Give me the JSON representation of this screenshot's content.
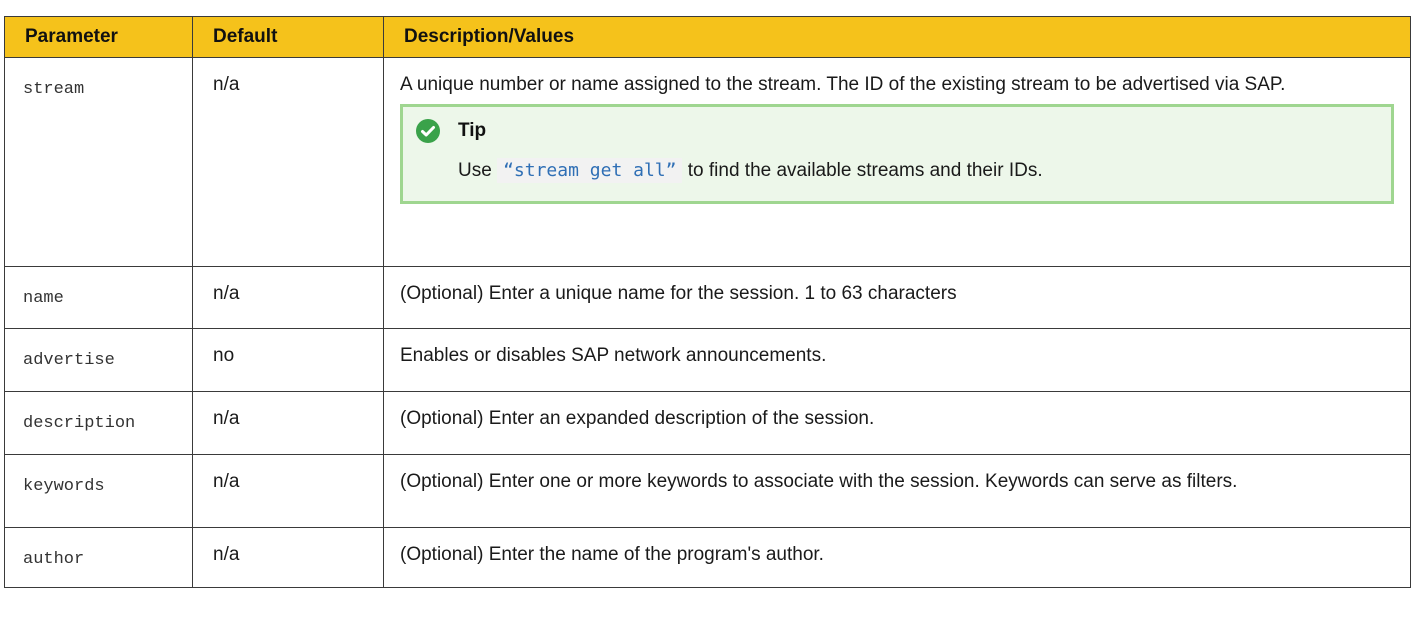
{
  "headers": {
    "parameter": "Parameter",
    "default": "Default",
    "description": "Description/Values"
  },
  "rows": [
    {
      "parameter": "stream",
      "default": "n/a",
      "description": "A unique number or name assigned to the stream. The ID of the existing stream to be advertised via SAP.",
      "tip": {
        "icon": "check-circle-icon",
        "title": "Tip",
        "prefix": "Use ",
        "code": "“stream get all”",
        "suffix": " to find the available streams and their IDs."
      }
    },
    {
      "parameter": "name",
      "default": "n/a",
      "description": "(Optional) Enter a unique name for the session. 1 to 63 characters"
    },
    {
      "parameter": "advertise",
      "default": "no",
      "description": "Enables or disables SAP network announcements."
    },
    {
      "parameter": "description",
      "default": "n/a",
      "description": "(Optional) Enter an expanded description of the session."
    },
    {
      "parameter": "keywords",
      "default": "n/a",
      "description": "(Optional) Enter one or more keywords to associate with the session. Keywords can serve as filters."
    },
    {
      "parameter": "author",
      "default": "n/a",
      "description": "(Optional) Enter the name of the program's author."
    }
  ],
  "colors": {
    "header_bg": "#f5c21b",
    "tip_bg": "#edf7ea",
    "tip_border": "#9fd690",
    "tip_icon": "#3aa24a",
    "code_text": "#2f6fb5"
  }
}
